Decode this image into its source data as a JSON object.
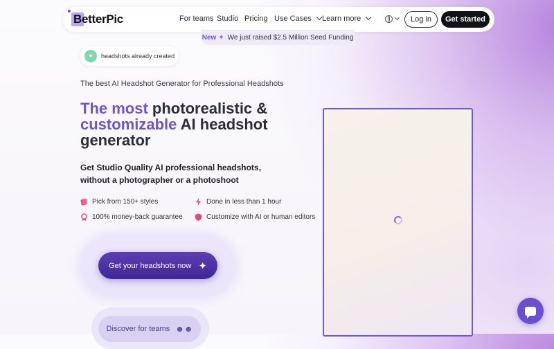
{
  "nav": {
    "brand": "BetterPic",
    "links": [
      {
        "label": "For teams",
        "dropdown": false
      },
      {
        "label": "Studio",
        "dropdown": false
      },
      {
        "label": "Pricing",
        "dropdown": false
      },
      {
        "label": "Use Cases",
        "dropdown": true
      },
      {
        "label": "Learn more",
        "dropdown": true
      }
    ],
    "login_label": "Log in",
    "get_started_label": "Get started"
  },
  "announcement": {
    "tag": "New",
    "text": "We just raised $2.5 Million Seed Funding"
  },
  "badge": {
    "text": "headshots already created"
  },
  "hero": {
    "tagline": "The best AI Headshot Generator for Professional Headshots",
    "title_part1": "The most",
    "title_part2": "photorealistic &",
    "title_part3": "customizable",
    "title_part4": "AI headshot generator",
    "subheading": "Get Studio Quality AI professional headshots, without a photographer or a photoshoot"
  },
  "features": [
    {
      "icon": "styles-icon",
      "text": "Pick from 150+ styles"
    },
    {
      "icon": "lightning-icon",
      "text": "Done in less than 1 hour"
    },
    {
      "icon": "guarantee-icon",
      "text": "100% money-back guarantee"
    },
    {
      "icon": "shield-icon",
      "text": "Customize with AI or human editors"
    }
  ],
  "cta": {
    "primary_label": "Get your headshots now",
    "secondary_label": "Discover for teams"
  },
  "colors": {
    "accent": "#6d55c9",
    "cta": "#4a2fa0",
    "frame_border": "#6a5ad8"
  }
}
